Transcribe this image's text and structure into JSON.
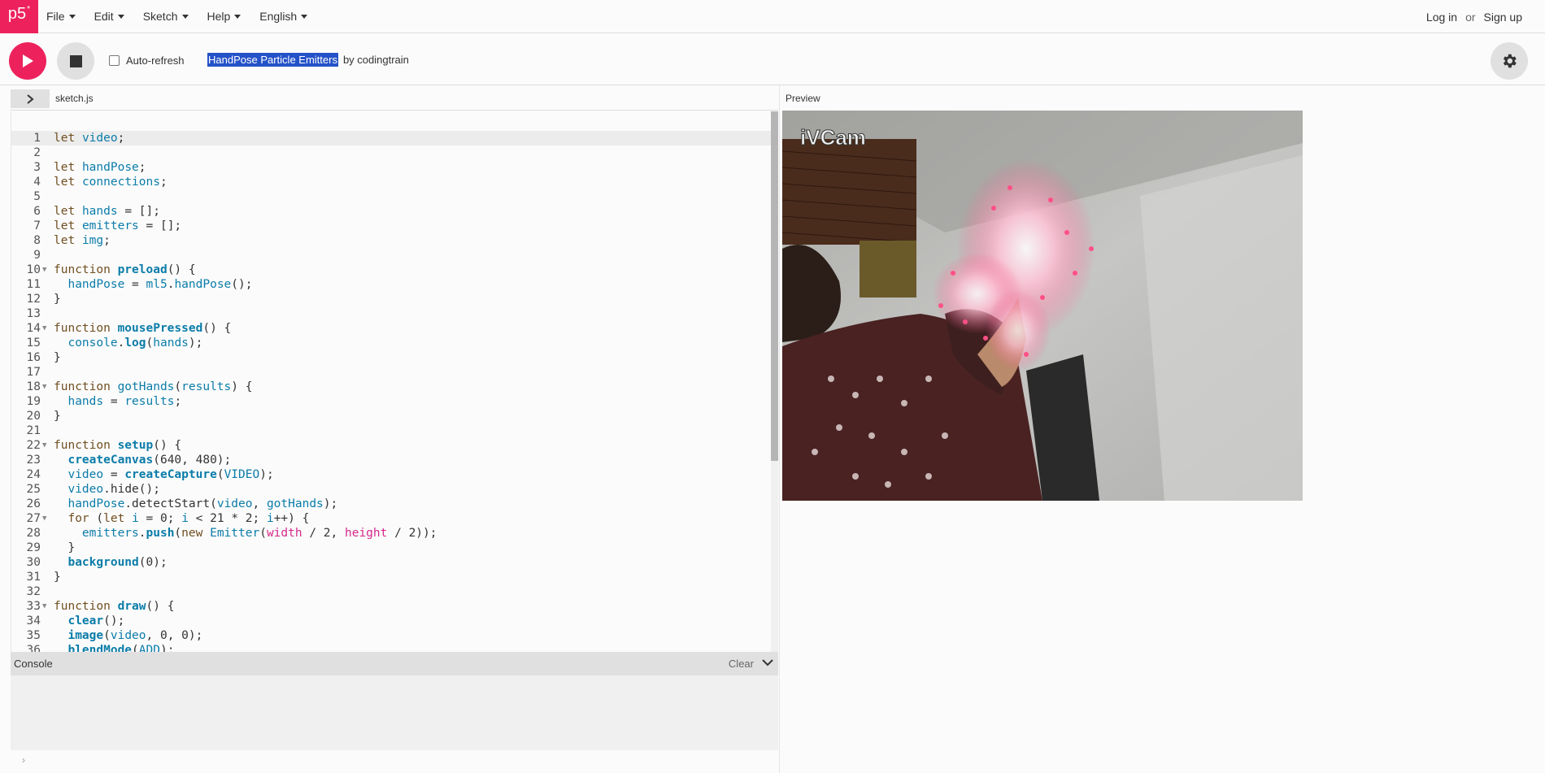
{
  "nav": {
    "logo": "p5",
    "logo_sup": "*",
    "menu": [
      "File",
      "Edit",
      "Sketch",
      "Help",
      "English"
    ],
    "login": "Log in",
    "or": "or",
    "signup": "Sign up"
  },
  "toolbar": {
    "autorefresh_label": "Auto-refresh",
    "autorefresh_checked": false,
    "sketch_title": "HandPose Particle Emitters",
    "by": "by codingtrain"
  },
  "editor": {
    "file_name": "sketch.js",
    "active_line": 1,
    "lines": [
      "let video;",
      "",
      "let handPose;",
      "let connections;",
      "",
      "let hands = [];",
      "let emitters = [];",
      "let img;",
      "",
      "function preload() {",
      "  handPose = ml5.handPose();",
      "}",
      "",
      "function mousePressed() {",
      "  console.log(hands);",
      "}",
      "",
      "function gotHands(results) {",
      "  hands = results;",
      "}",
      "",
      "function setup() {",
      "  createCanvas(640, 480);",
      "  video = createCapture(VIDEO);",
      "  video.hide();",
      "  handPose.detectStart(video, gotHands);",
      "  for (let i = 0; i < 21 * 2; i++) {",
      "    emitters.push(new Emitter(width / 2, height / 2));",
      "  }",
      "  background(0);",
      "}",
      "",
      "function draw() {",
      "  clear();",
      "  image(video, 0, 0);",
      "  blendMode(ADD);"
    ],
    "fold_lines": [
      10,
      14,
      18,
      22,
      27,
      33
    ]
  },
  "console": {
    "title": "Console",
    "clear_label": "Clear",
    "prompt": "›"
  },
  "preview": {
    "label": "Preview",
    "watermark": "iVCam"
  },
  "colors": {
    "accent": "#ed225d",
    "selection": "#2452c8"
  }
}
